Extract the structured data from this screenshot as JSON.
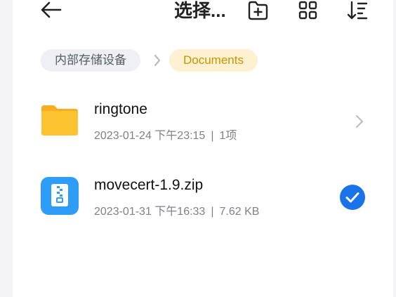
{
  "header": {
    "title": "选择...",
    "back_icon": "arrow-left-icon",
    "actions": [
      "new-folder-icon",
      "grid-view-icon",
      "sort-icon"
    ]
  },
  "breadcrumb": {
    "root": "内部存储设备",
    "current": "Documents"
  },
  "files": [
    {
      "name": "ringtone",
      "date": "2023-01-24 下午23:15",
      "detail": "1项",
      "type": "folder",
      "selected": false
    },
    {
      "name": "movecert-1.9.zip",
      "date": "2023-01-31 下午16:33",
      "detail": "7.62 KB",
      "type": "zip",
      "selected": true
    }
  ],
  "separator": "|",
  "colors": {
    "folder": "#fcc230",
    "zip": "#2e9df8",
    "accent": "#1a73e8",
    "crumb_active_bg": "#fdf1d2",
    "crumb_active_text": "#c99500"
  }
}
